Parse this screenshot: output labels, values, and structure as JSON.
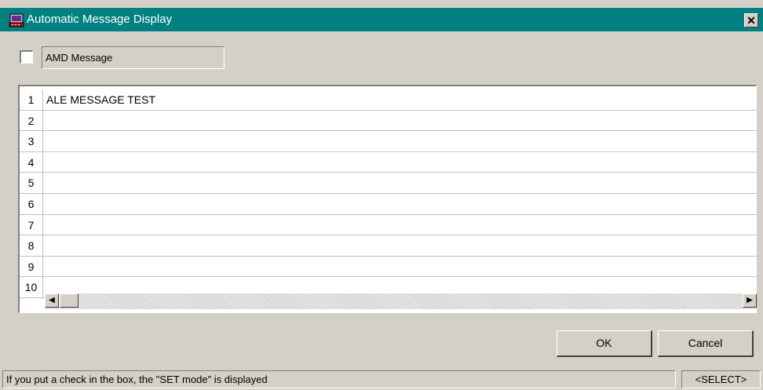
{
  "window": {
    "title": "Automatic Message Display",
    "close_label": "✕",
    "icon": "app-computer-icon"
  },
  "amd": {
    "checked": false,
    "label": "AMD Message"
  },
  "grid": {
    "rows": [
      {
        "num": "1",
        "text": "ALE MESSAGE TEST"
      },
      {
        "num": "2",
        "text": ""
      },
      {
        "num": "3",
        "text": ""
      },
      {
        "num": "4",
        "text": ""
      },
      {
        "num": "5",
        "text": ""
      },
      {
        "num": "6",
        "text": ""
      },
      {
        "num": "7",
        "text": ""
      },
      {
        "num": "8",
        "text": ""
      },
      {
        "num": "9",
        "text": ""
      },
      {
        "num": "10",
        "text": ""
      }
    ]
  },
  "buttons": {
    "ok": "OK",
    "cancel": "Cancel"
  },
  "status": {
    "message": "If you put a check in the box, the \"SET mode\" is displayed",
    "mode": "<SELECT>"
  },
  "colors": {
    "titlebar": "#008080",
    "face": "#d4d0c8"
  }
}
